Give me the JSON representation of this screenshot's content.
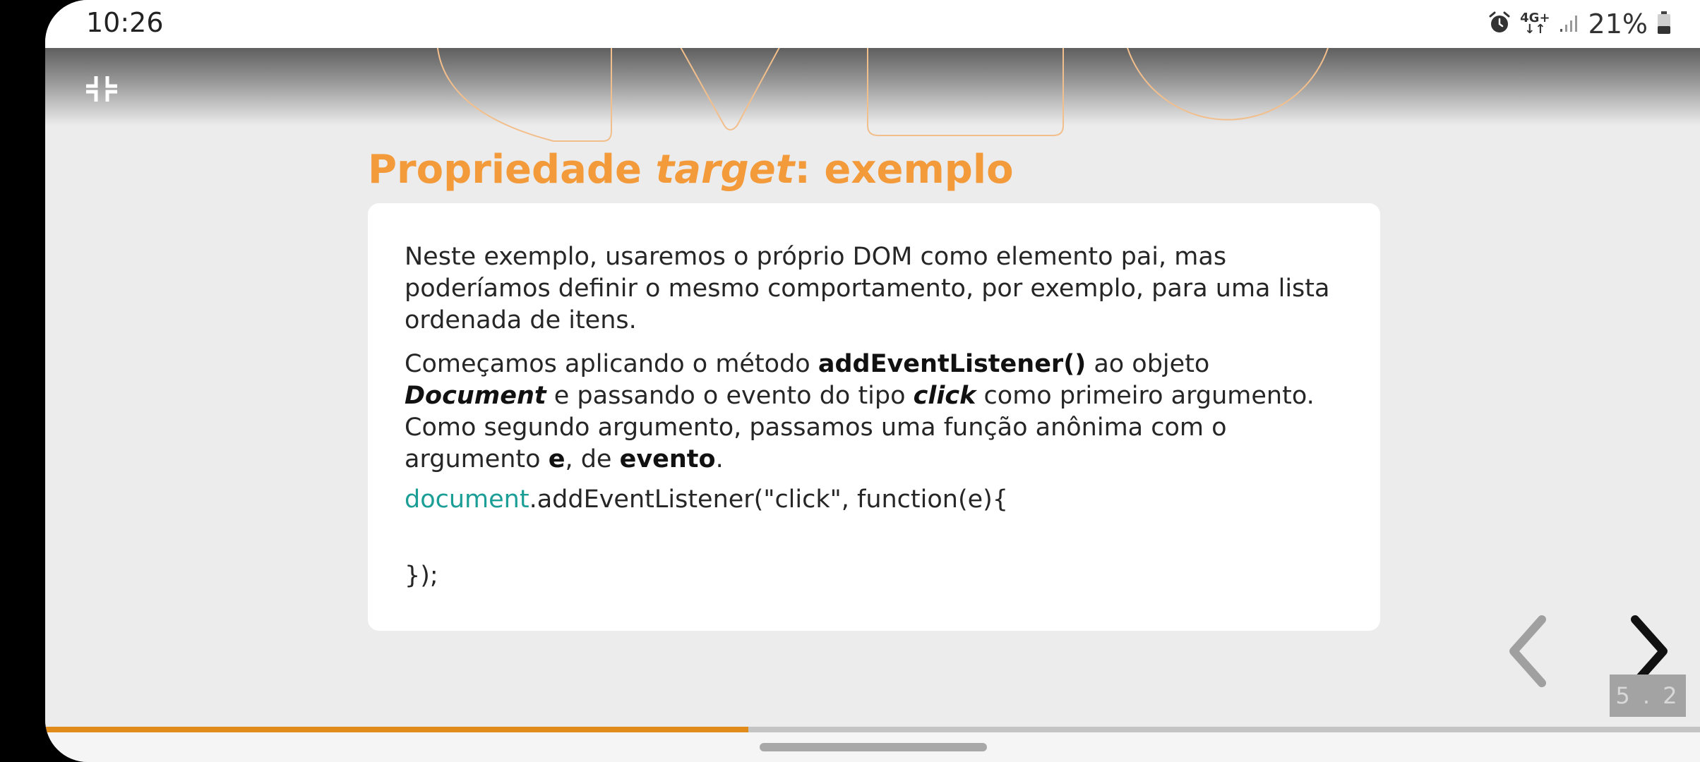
{
  "status_bar": {
    "time": "10:26",
    "network": "4G+",
    "battery_percent": "21%",
    "icons": [
      "alarm-icon",
      "network-4g-icon",
      "signal-icon",
      "battery-icon"
    ]
  },
  "toolbar": {
    "collapse_icon": "collapse-fullscreen-icon"
  },
  "slide": {
    "title_part1": "Propriedade ",
    "title_italic": "target",
    "title_part2": ": exemplo",
    "title_color": "#f39a3b",
    "paragraph1": "Neste exemplo, usaremos o próprio DOM como elemento pai, mas poderíamos definir o mesmo comportamento, por exemplo, para uma lista ordenada de itens.",
    "paragraph2": {
      "t1": "Começamos aplicando o método ",
      "b1": "addEventListener()",
      "t2": " ao objeto ",
      "bi1": "Document",
      "t3": " e passando o evento do tipo ",
      "bi2": "click",
      "t4": " como primeiro argumento. Como segundo argumento, passamos uma função anônima com o argumento ",
      "b2": "e",
      "t5": ", de ",
      "b3": "evento",
      "t6": "."
    },
    "code_line1_keyword": "document",
    "code_line1_rest": ".addEventListener(\"click\", function(e){",
    "code_line2": "});",
    "keyword_color": "#1a9e96"
  },
  "navigation": {
    "prev_icon": "chevron-left-icon",
    "next_icon": "chevron-right-icon",
    "page_indicator": "5 . 2"
  },
  "progress": {
    "fraction": 0.425,
    "color": "#e08b1a"
  }
}
